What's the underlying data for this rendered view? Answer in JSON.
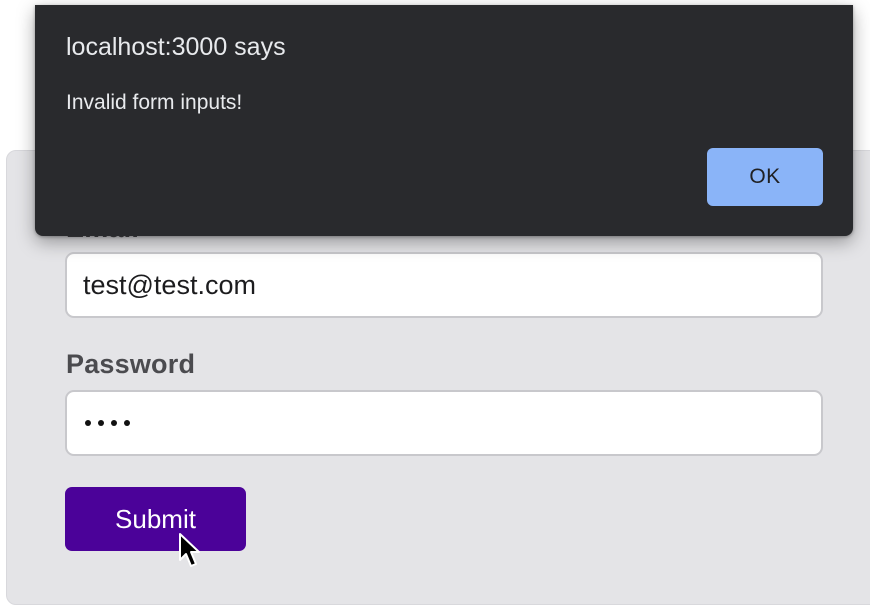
{
  "alert": {
    "title": "localhost:3000 says",
    "message": "Invalid form inputs!",
    "ok_label": "OK"
  },
  "form": {
    "email_label": "Email",
    "email_value": "test@test.com",
    "password_label": "Password",
    "password_length": 4,
    "submit_label": "Submit"
  },
  "colors": {
    "dialog_background": "#292a2d",
    "ok_button": "#8ab4f8",
    "submit_button": "#4b0299",
    "form_background": "#e4e4e7"
  }
}
